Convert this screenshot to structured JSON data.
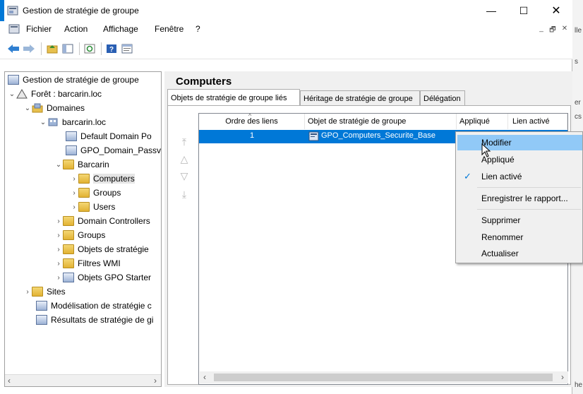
{
  "window": {
    "title": "Gestion de stratégie de groupe",
    "controls": {
      "minimize": "—",
      "maximize": "☐",
      "close": "✕"
    }
  },
  "menubar": {
    "items": [
      "Fichier",
      "Action",
      "Affichage",
      "Fenêtre",
      "?"
    ],
    "mdi_controls": [
      "_",
      "🗗",
      "✕"
    ]
  },
  "tree": {
    "nodes": [
      {
        "label": "Gestion de stratégie de groupe",
        "icon": "gpmc-icon"
      },
      {
        "label": "Forêt : barcarin.loc",
        "icon": "forest-icon"
      },
      {
        "label": "Domaines",
        "icon": "domains-icon"
      },
      {
        "label": "barcarin.loc",
        "icon": "domain-icon"
      },
      {
        "label": "Default Domain Po",
        "icon": "gpo-link-icon"
      },
      {
        "label": "GPO_Domain_Passv",
        "icon": "gpo-link-icon"
      },
      {
        "label": "Barcarin",
        "icon": "ou-folder-icon"
      },
      {
        "label": "Computers",
        "icon": "ou-folder-icon"
      },
      {
        "label": "Groups",
        "icon": "ou-folder-icon"
      },
      {
        "label": "Users",
        "icon": "ou-folder-icon"
      },
      {
        "label": "Domain Controllers",
        "icon": "ou-folder-icon"
      },
      {
        "label": "Groups",
        "icon": "ou-folder-icon"
      },
      {
        "label": "Objets de stratégie",
        "icon": "gpo-container-icon"
      },
      {
        "label": "Filtres WMI",
        "icon": "wmi-filter-icon"
      },
      {
        "label": "Objets GPO Starter",
        "icon": "starter-gpo-icon"
      },
      {
        "label": "Sites",
        "icon": "sites-icon"
      },
      {
        "label": "Modélisation de stratégie c",
        "icon": "modeling-icon"
      },
      {
        "label": "Résultats de stratégie de gi",
        "icon": "results-icon"
      }
    ]
  },
  "main": {
    "heading": "Computers",
    "tabs": [
      "Objets de stratégie de groupe liés",
      "Héritage de stratégie de groupe",
      "Délégation"
    ],
    "columns": [
      "Ordre des liens",
      "Objet de stratégie de groupe",
      "Appliqué",
      "Lien activé"
    ],
    "rows": [
      {
        "order": "1",
        "gpo": "GPO_Computers_Securite_Base"
      }
    ]
  },
  "context_menu": {
    "items": [
      "Modifier",
      "Appliqué",
      "Lien activé",
      "Enregistrer le rapport...",
      "Supprimer",
      "Renommer",
      "Actualiser"
    ],
    "highlighted": "Modifier",
    "checked": "Lien activé"
  },
  "background_window": {
    "fragments": [
      "lle",
      "s",
      "er",
      "cs",
      "he"
    ]
  },
  "colors": {
    "selection": "#0078d7",
    "menu_highlight": "#91c9f7"
  }
}
